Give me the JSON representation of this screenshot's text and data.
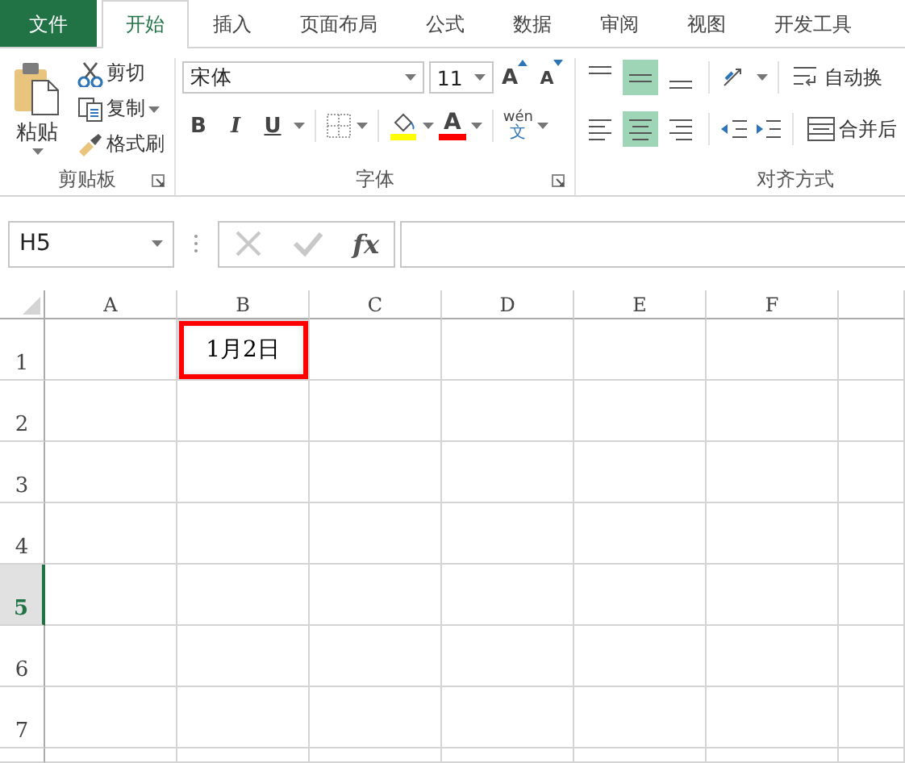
{
  "tabs": [
    {
      "label": "文件",
      "kind": "file",
      "selected": false
    },
    {
      "label": "开始",
      "kind": "tab",
      "selected": true
    },
    {
      "label": "插入",
      "kind": "tab",
      "selected": false
    },
    {
      "label": "页面布局",
      "kind": "tab",
      "selected": false
    },
    {
      "label": "公式",
      "kind": "tab",
      "selected": false
    },
    {
      "label": "数据",
      "kind": "tab",
      "selected": false
    },
    {
      "label": "审阅",
      "kind": "tab",
      "selected": false
    },
    {
      "label": "视图",
      "kind": "tab",
      "selected": false
    },
    {
      "label": "开发工具",
      "kind": "tab",
      "selected": false
    }
  ],
  "ribbon": {
    "clipboard": {
      "paste": "粘贴",
      "cut": "剪切",
      "copy": "复制",
      "format_painter": "格式刷",
      "group_label": "剪贴板"
    },
    "font": {
      "font_name": "宋体",
      "font_size": "11",
      "grow": "A",
      "shrink": "A",
      "bold": "B",
      "italic": "I",
      "underline": "U",
      "font_color_letter": "A",
      "phonetic_top": "wén",
      "phonetic_bottom": "文",
      "group_label": "字体"
    },
    "alignment": {
      "vertical": [
        {
          "kind": "top",
          "selected": false
        },
        {
          "kind": "middle",
          "selected": true
        },
        {
          "kind": "bottom",
          "selected": false
        }
      ],
      "horizontal": [
        {
          "kind": "left",
          "selected": false
        },
        {
          "kind": "center",
          "selected": true
        },
        {
          "kind": "right",
          "selected": false
        }
      ],
      "wrap_text": "自动换",
      "merge": "合并后",
      "group_label": "对齐方式"
    }
  },
  "formula_bar": {
    "name_box": "H5",
    "function": "fx"
  },
  "grid": {
    "columns": [
      {
        "label": "A",
        "selected": false
      },
      {
        "label": "B",
        "selected": false
      },
      {
        "label": "C",
        "selected": false
      },
      {
        "label": "D",
        "selected": false
      },
      {
        "label": "E",
        "selected": false
      },
      {
        "label": "F",
        "selected": false
      }
    ],
    "rows": [
      {
        "label": "1",
        "selected": false,
        "cells": {
          "B": {
            "value": "1月2日",
            "highlighted": true
          }
        }
      },
      {
        "label": "2",
        "selected": false
      },
      {
        "label": "3",
        "selected": false
      },
      {
        "label": "4",
        "selected": false
      },
      {
        "label": "5",
        "selected": true
      },
      {
        "label": "6",
        "selected": false
      },
      {
        "label": "7",
        "selected": false
      }
    ]
  }
}
